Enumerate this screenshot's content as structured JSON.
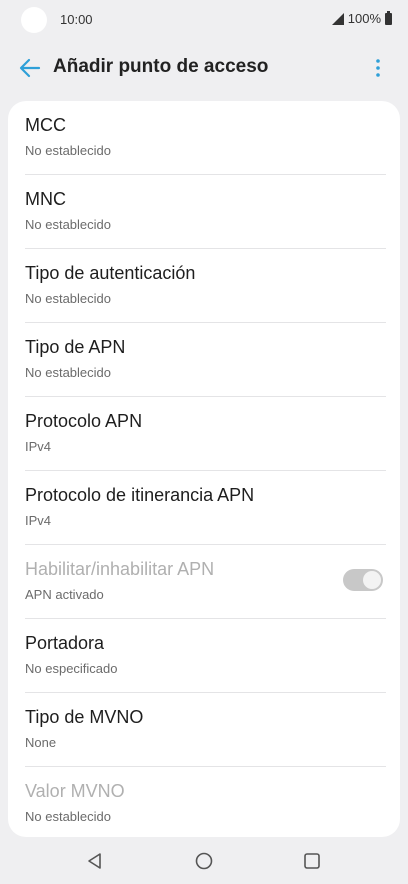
{
  "status_bar": {
    "time": "10:00",
    "battery": "100%",
    "icons": [
      "camera-cutout",
      "signal-icon",
      "battery-icon"
    ]
  },
  "header": {
    "title": "Añadir punto de acceso",
    "back_icon": "arrow-left-icon",
    "more_icon": "more-vertical-icon",
    "accent_color": "#2e9fd8"
  },
  "settings": [
    {
      "label": "MCC",
      "value": "No establecido"
    },
    {
      "label": "MNC",
      "value": "No establecido"
    },
    {
      "label": "Tipo de autenticación",
      "value": "No establecido"
    },
    {
      "label": "Tipo de APN",
      "value": "No establecido"
    },
    {
      "label": "Protocolo APN",
      "value": "IPv4"
    },
    {
      "label": "Protocolo de itinerancia APN",
      "value": "IPv4"
    },
    {
      "label": "Habilitar/inhabilitar APN",
      "value": "APN activado",
      "disabled": true,
      "toggle": true,
      "toggle_on": true
    },
    {
      "label": "Portadora",
      "value": "No especificado"
    },
    {
      "label": "Tipo de MVNO",
      "value": "None"
    },
    {
      "label": "Valor MVNO",
      "value": "No establecido",
      "disabled": true
    }
  ],
  "nav_bar": {
    "icons": [
      "back-triangle-icon",
      "home-circle-icon",
      "recents-square-icon"
    ]
  }
}
